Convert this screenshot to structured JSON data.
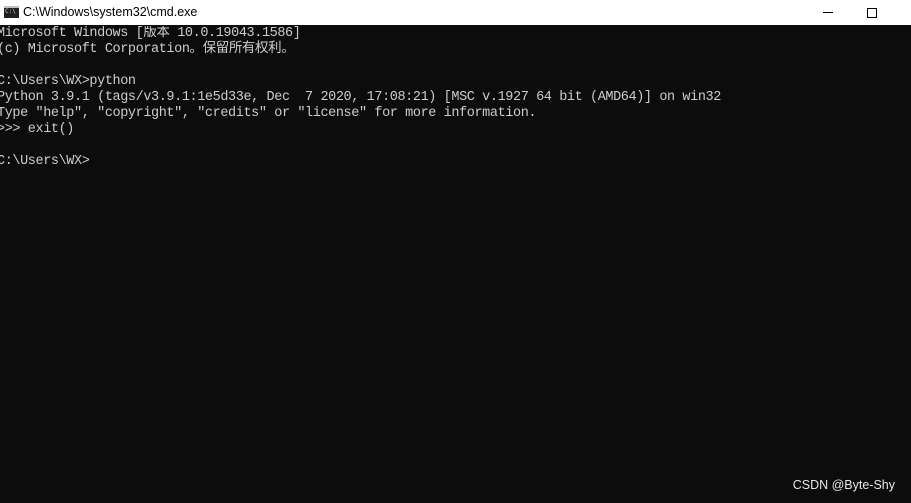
{
  "window": {
    "title": "C:\\Windows\\system32\\cmd.exe",
    "icon": "cmd-console-icon",
    "controls": {
      "minimize_icon": "minimize-icon",
      "maximize_icon": "maximize-icon"
    }
  },
  "console": {
    "lines": [
      "Microsoft Windows [版本 10.0.19043.1586]",
      "(c) Microsoft Corporation。保留所有权利。",
      "",
      "C:\\Users\\WX>python",
      "Python 3.9.1 (tags/v3.9.1:1e5d33e, Dec  7 2020, 17:08:21) [MSC v.1927 64 bit (AMD64)] on win32",
      "Type \"help\", \"copyright\", \"credits\" or \"license\" for more information.",
      ">>> exit()",
      "",
      "C:\\Users\\WX>"
    ]
  },
  "watermark": {
    "text": "CSDN @Byte-Shy"
  },
  "colors": {
    "console_background": "#0c0c0c",
    "console_text": "#cccccc",
    "titlebar_background": "#ffffff",
    "titlebar_text": "#000000"
  }
}
